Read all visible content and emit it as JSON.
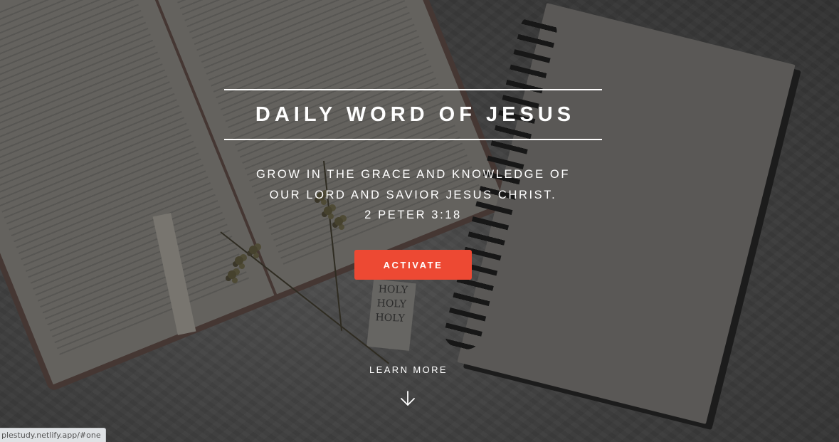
{
  "hero": {
    "title": "DAILY WORD OF JESUS",
    "subtitle_lines": [
      "GROW IN THE GRACE AND KNOWLEDGE OF",
      "OUR LORD AND SAVIOR JESUS CHRIST.",
      "2 PETER 3:18"
    ],
    "activate_label": "ACTIVATE",
    "learn_more_label": "LEARN MORE",
    "card_words": [
      "HOLY",
      "HOLY",
      "HOLY"
    ]
  },
  "status_bar": {
    "url": "plestudy.netlify.app/#one"
  },
  "colors": {
    "accent": "#ed4933",
    "text": "#ffffff",
    "overlay": "rgba(30,30,30,0.35)"
  },
  "icons": {
    "learn_more": "arrow-down-icon"
  }
}
